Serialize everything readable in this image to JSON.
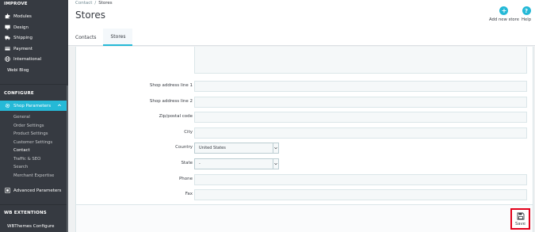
{
  "sidebar": {
    "improve_heading": "IMPROVE",
    "improve_items": [
      {
        "label": "Modules",
        "icon": "puzzle-icon"
      },
      {
        "label": "Design",
        "icon": "monitor-icon"
      },
      {
        "label": "Shipping",
        "icon": "truck-icon"
      },
      {
        "label": "Payment",
        "icon": "credit-card-icon"
      },
      {
        "label": "International",
        "icon": "globe-icon"
      }
    ],
    "webi_blog": "Webi Blog",
    "configure_heading": "CONFIGURE",
    "shop_parameters": "Shop Parameters",
    "sub_items": [
      "General",
      "Order Settings",
      "Product Settings",
      "Customer Settings",
      "Contact",
      "Traffic & SEO",
      "Search",
      "Merchant Expertise"
    ],
    "current_sub": "Contact",
    "advanced_parameters": "Advanced Parameters",
    "wb_heading": "WB EXTENTIONS",
    "wbthemes": "WBThemes Configure"
  },
  "header": {
    "breadcrumb": [
      "Contact",
      "Stores"
    ],
    "breadcrumb_sep": "/",
    "title": "Stores",
    "tabs": [
      {
        "label": "Contacts",
        "active": false
      },
      {
        "label": "Stores",
        "active": true
      }
    ],
    "add_new_store": "Add new store",
    "help": "Help"
  },
  "form": {
    "fields": [
      {
        "label": "Shop address line 1",
        "value": ""
      },
      {
        "label": "Shop address line 2",
        "value": ""
      },
      {
        "label": "Zip/postal code",
        "value": ""
      },
      {
        "label": "City",
        "value": ""
      }
    ],
    "country_label": "Country",
    "country_value": "United States",
    "state_label": "State",
    "state_value": "-",
    "phone_label": "Phone",
    "fax_label": "Fax",
    "save_label": "Save"
  },
  "colors": {
    "sidebar_bg": "#363a41",
    "accent": "#25b9d7",
    "highlight_border": "#e2001a"
  }
}
